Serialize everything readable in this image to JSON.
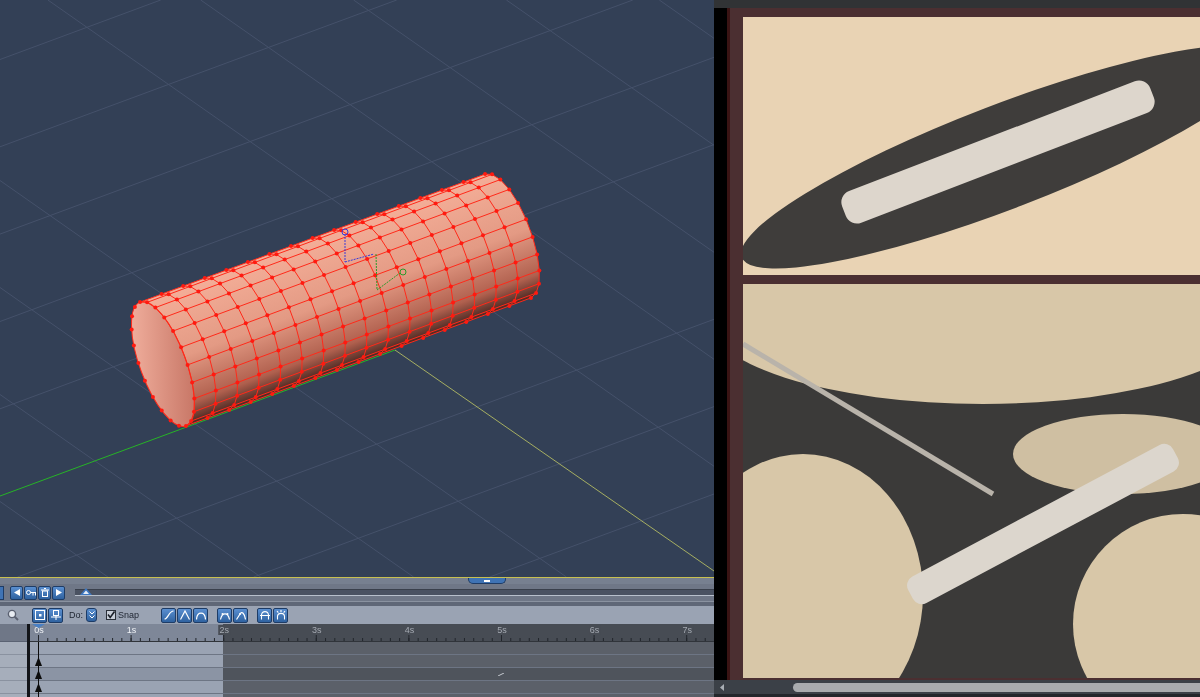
{
  "timeline": {
    "scrub_slider": {
      "level": 0.008
    },
    "do_field": {
      "label": "Do:"
    },
    "snap": {
      "label": "Snap",
      "checked": true
    },
    "ruler": {
      "ticks": [
        "0s",
        "1s",
        "2s",
        "3s",
        "4s",
        "5s",
        "6s",
        "7s"
      ],
      "playhead": {
        "level": 0.012
      },
      "play_range": {
        "level": 0.282
      }
    },
    "tracks": [
      {
        "keyed": false,
        "curve_mark": false
      },
      {
        "keyed": true,
        "curve_mark": false
      },
      {
        "keyed": true,
        "curve_mark": true
      },
      {
        "keyed": true,
        "curve_mark": false
      }
    ]
  }
}
